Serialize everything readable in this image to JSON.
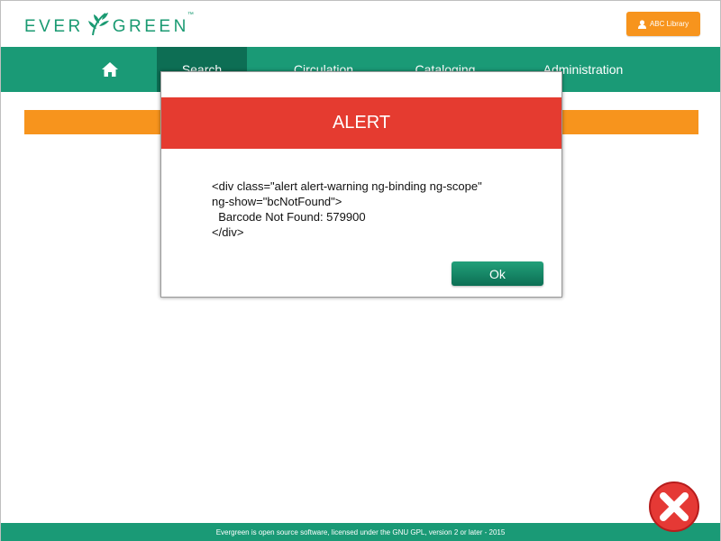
{
  "header": {
    "logo_left": "EVER",
    "logo_right": "GREEN",
    "logo_tm": "™",
    "library_label": "ABC Library",
    "icons": {
      "user": "user-icon",
      "leaf": "leaf-icon"
    }
  },
  "nav": {
    "home_icon": "home-icon",
    "items": [
      "Search",
      "Circulation",
      "Cataloging",
      "Administration"
    ]
  },
  "modal": {
    "title": "ALERT",
    "body": {
      "line1": "<div class=\"alert alert-warning ng-binding ng-scope\"",
      "line2": "ng-show=\"bcNotFound\">",
      "line3": "  Barcode Not Found: 579900",
      "line4": "</div>"
    },
    "ok_label": "Ok"
  },
  "footer": {
    "text": "Evergreen is open source software, licensed under the GNU GPL, version 2 or later - 2015"
  },
  "colors": {
    "brand_green": "#1a9a76",
    "nav_active": "#0d6e54",
    "accent_orange": "#f7941d",
    "alert_red": "#e53b30",
    "close_red": "#e53935"
  },
  "overlay_icon": "close-icon"
}
